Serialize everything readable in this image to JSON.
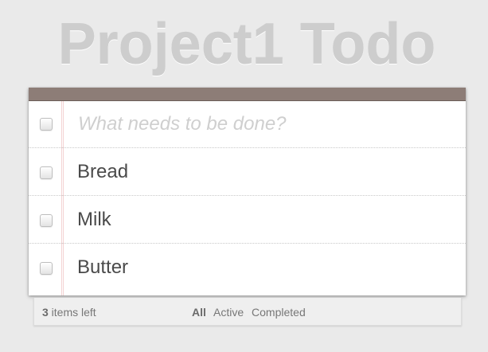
{
  "header": {
    "title": "Project1 Todo"
  },
  "new_todo": {
    "placeholder": "What needs to be done?",
    "value": ""
  },
  "todos": [
    {
      "label": "Bread",
      "completed": false
    },
    {
      "label": "Milk",
      "completed": false
    },
    {
      "label": "Butter",
      "completed": false
    }
  ],
  "footer": {
    "count": "3",
    "count_suffix": " items left",
    "filters": [
      {
        "label": "All",
        "selected": true
      },
      {
        "label": "Active",
        "selected": false
      },
      {
        "label": "Completed",
        "selected": false
      }
    ]
  },
  "colors": {
    "background": "#eaeaea",
    "top_bar": "#8d7d77",
    "title_text": "#cdcdcd"
  }
}
